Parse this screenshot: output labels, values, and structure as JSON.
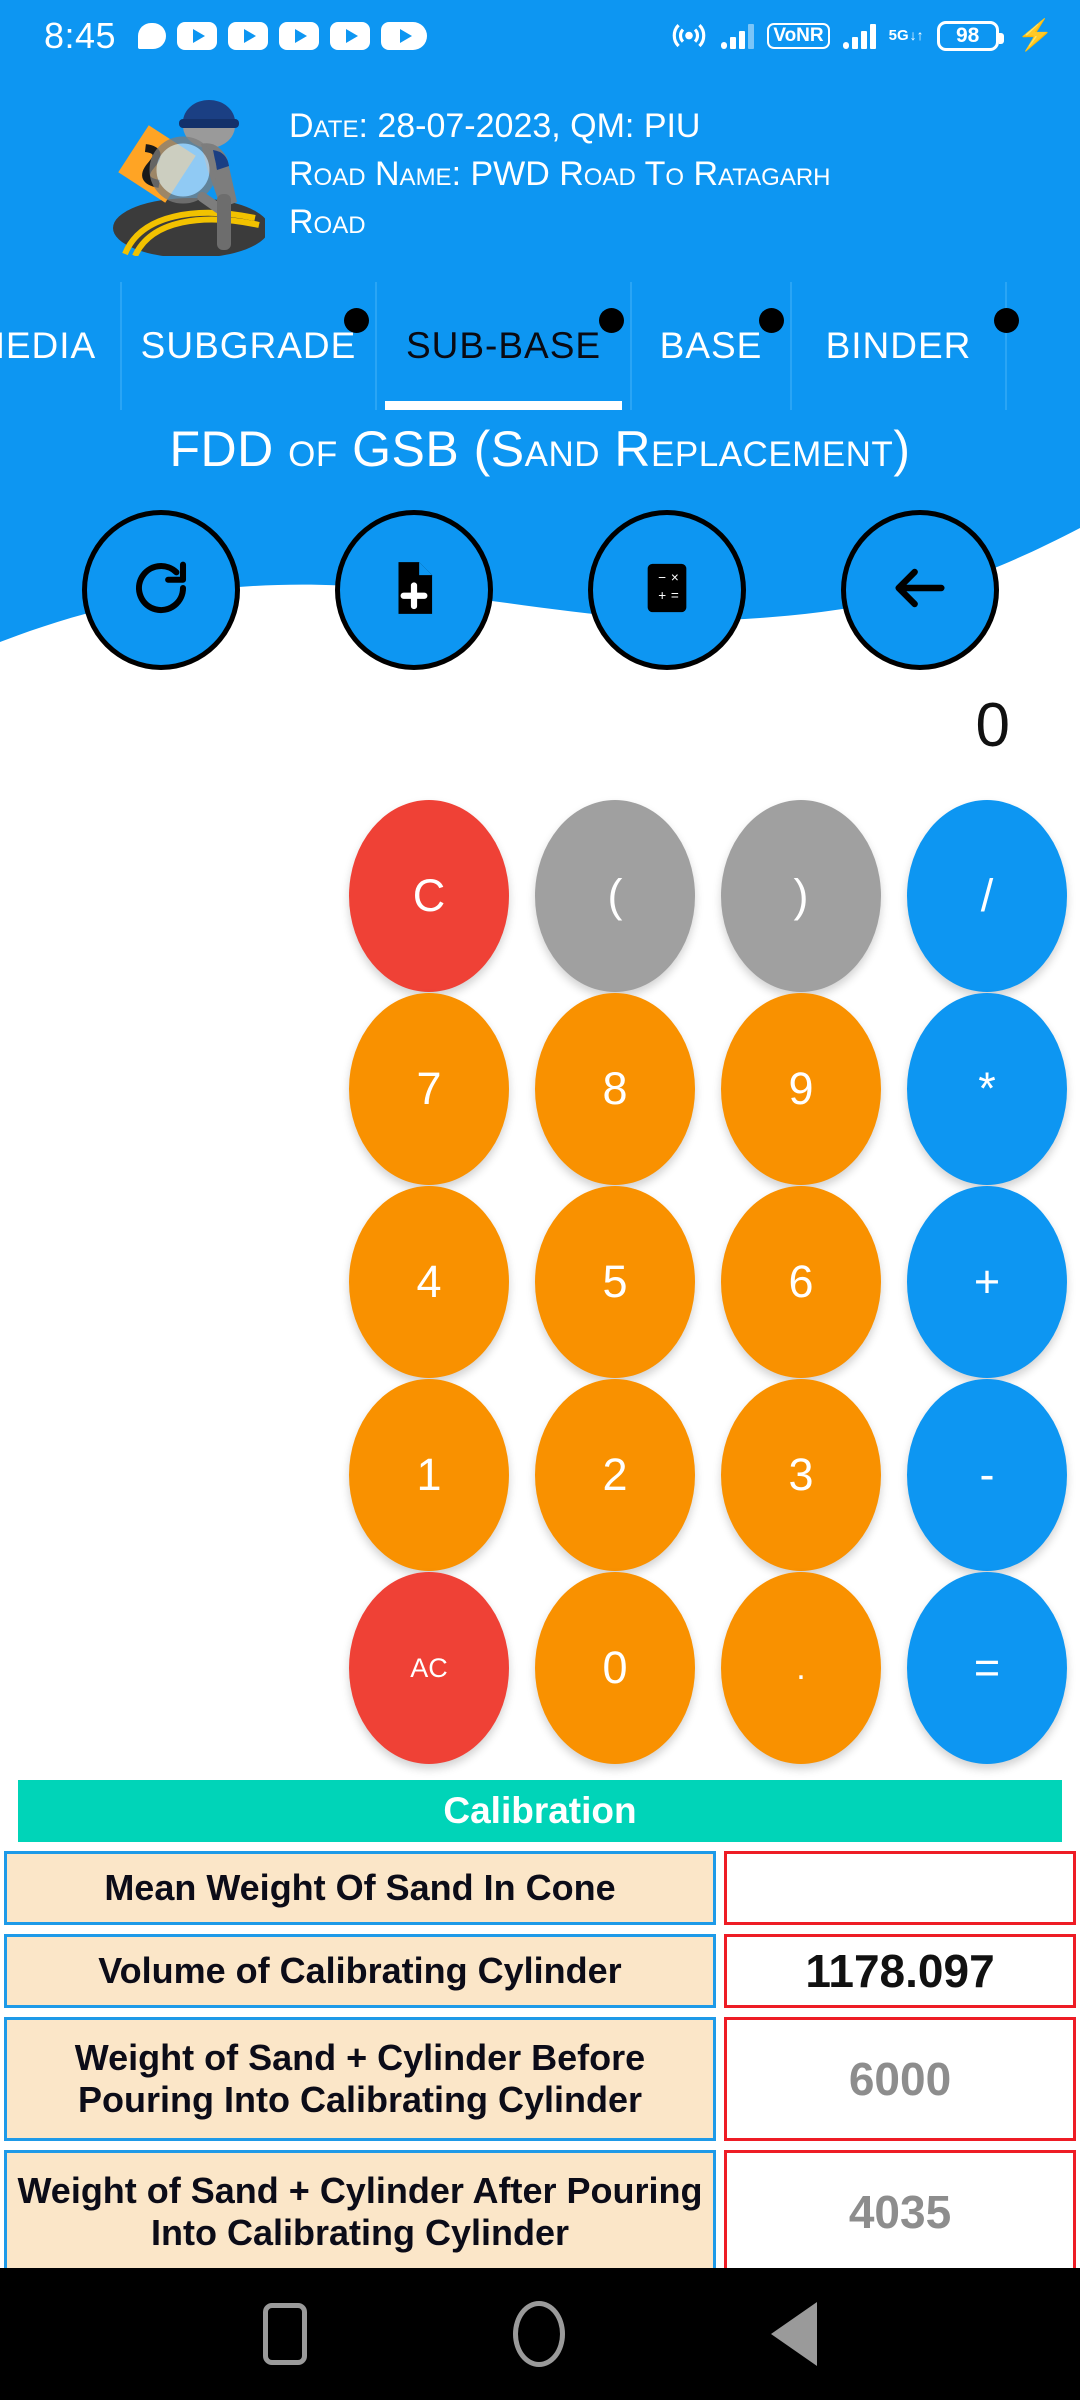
{
  "status_bar": {
    "time": "8:45",
    "left_icons": [
      "chat-bubble-icon",
      "video-play-icon",
      "video-play-icon",
      "video-play-icon",
      "video-play-icon",
      "video-play-icon"
    ],
    "right_icons": [
      "hotspot-icon",
      "signal-bars-icon",
      "vonr-badge",
      "signal-bars-icon",
      "network-5g-icon",
      "battery-icon",
      "charging-bolt-icon"
    ],
    "vonr_label": "VoNR",
    "network_label": "5G",
    "network_arrows": "↓↑",
    "battery_level": "98",
    "charging_glyph": "⚡"
  },
  "header": {
    "logo_name": "road-inspector-logo",
    "line1": "Date: 28-07-2023, QM: PIU",
    "line2": "Road Name: PWD Road To Ratagarh",
    "line3": "Road"
  },
  "tabs": {
    "items": [
      {
        "label": "MEDIA",
        "selected": false,
        "has_badge": false
      },
      {
        "label": "SUBGRADE",
        "selected": false,
        "has_badge": true
      },
      {
        "label": "SUB-BASE",
        "selected": true,
        "has_badge": true
      },
      {
        "label": "BASE",
        "selected": false,
        "has_badge": true
      },
      {
        "label": "BINDER",
        "selected": false,
        "has_badge": true
      }
    ]
  },
  "hero": {
    "title": "FDD of GSB (Sand Replacement)",
    "actions": [
      {
        "name": "refresh-button",
        "icon": "refresh-icon"
      },
      {
        "name": "new-file-button",
        "icon": "file-add-icon"
      },
      {
        "name": "calculator-button",
        "icon": "calculator-icon"
      },
      {
        "name": "back-button",
        "icon": "arrow-left-icon"
      }
    ]
  },
  "calculator": {
    "display_value": "0",
    "rows": [
      [
        {
          "label": "C",
          "style": "k-red",
          "size": ""
        },
        {
          "label": "(",
          "style": "k-gray",
          "size": ""
        },
        {
          "label": ")",
          "style": "k-gray",
          "size": ""
        },
        {
          "label": "/",
          "style": "k-blue",
          "size": ""
        }
      ],
      [
        {
          "label": "7",
          "style": "k-orange",
          "size": ""
        },
        {
          "label": "8",
          "style": "k-orange",
          "size": ""
        },
        {
          "label": "9",
          "style": "k-orange",
          "size": ""
        },
        {
          "label": "*",
          "style": "k-blue",
          "size": ""
        }
      ],
      [
        {
          "label": "4",
          "style": "k-orange",
          "size": ""
        },
        {
          "label": "5",
          "style": "k-orange",
          "size": ""
        },
        {
          "label": "6",
          "style": "k-orange",
          "size": ""
        },
        {
          "label": "+",
          "style": "k-blue",
          "size": ""
        }
      ],
      [
        {
          "label": "1",
          "style": "k-orange",
          "size": ""
        },
        {
          "label": "2",
          "style": "k-orange",
          "size": ""
        },
        {
          "label": "3",
          "style": "k-orange",
          "size": ""
        },
        {
          "label": "-",
          "style": "k-blue",
          "size": ""
        }
      ],
      [
        {
          "label": "AC",
          "style": "k-red",
          "size": "small"
        },
        {
          "label": "0",
          "style": "k-orange",
          "size": ""
        },
        {
          "label": ".",
          "style": "k-orange",
          "size": "dot"
        },
        {
          "label": "=",
          "style": "k-blue",
          "size": ""
        }
      ]
    ]
  },
  "calibration": {
    "section_title": "Calibration",
    "rows": [
      {
        "label": "Mean Weight Of Sand In Cone",
        "value": "",
        "is_placeholder": false,
        "tall": false
      },
      {
        "label": "Volume of Calibrating Cylinder",
        "value": "1178.097",
        "is_placeholder": false,
        "tall": false
      },
      {
        "label": "Weight of Sand + Cylinder Before Pouring Into Calibrating Cylinder",
        "value": "6000",
        "is_placeholder": true,
        "tall": true
      },
      {
        "label": "Weight of Sand + Cylinder After Pouring Into Calibrating Cylinder",
        "value": "4035",
        "is_placeholder": true,
        "tall": true
      }
    ]
  },
  "nav_bar": {
    "items": [
      "recents-square-icon",
      "home-circle-icon",
      "back-triangle-icon"
    ]
  },
  "colors": {
    "brand_blue": "#0d96f2",
    "teal": "#00d4b8",
    "orange": "#f99100",
    "red": "#ef4136",
    "gray": "#a0a0a0",
    "label_beige": "#fbe6c8",
    "border_red": "#ee1c25",
    "border_blue": "#1e9ae8"
  }
}
